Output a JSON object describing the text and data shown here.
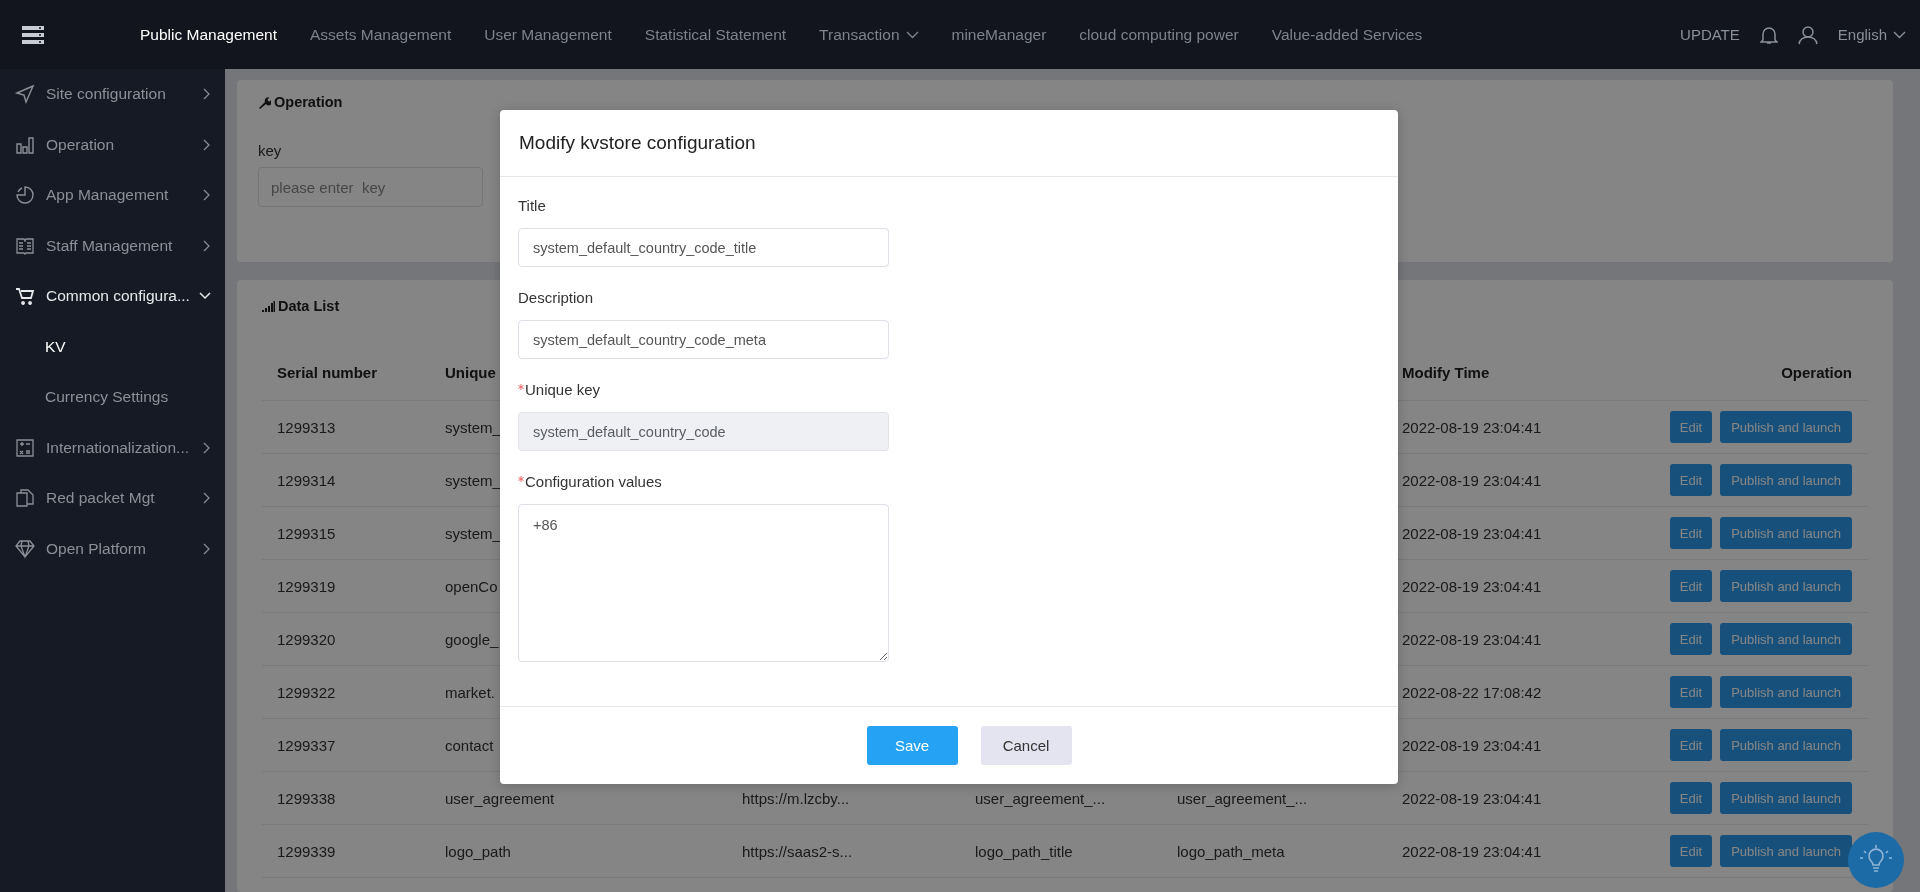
{
  "top_nav": {
    "items": [
      {
        "label": "Public Management",
        "selected": true,
        "has_dropdown": false
      },
      {
        "label": "Assets Management",
        "selected": false,
        "has_dropdown": false
      },
      {
        "label": "User Management",
        "selected": false,
        "has_dropdown": false
      },
      {
        "label": "Statistical Statement",
        "selected": false,
        "has_dropdown": false
      },
      {
        "label": "Transaction",
        "selected": false,
        "has_dropdown": true
      },
      {
        "label": "mineManager",
        "selected": false,
        "has_dropdown": false
      },
      {
        "label": "cloud computing power",
        "selected": false,
        "has_dropdown": false
      },
      {
        "label": "Value-added Services",
        "selected": false,
        "has_dropdown": false
      }
    ],
    "update_label": "UPDATE",
    "language": "English"
  },
  "sidebar": {
    "items": [
      {
        "label": "Site configuration",
        "expanded": false
      },
      {
        "label": "Operation",
        "expanded": false
      },
      {
        "label": "App Management",
        "expanded": false
      },
      {
        "label": "Staff Management",
        "expanded": false
      },
      {
        "label": "Common configura...",
        "expanded": true,
        "children": [
          {
            "label": "KV",
            "selected": true
          },
          {
            "label": "Currency Settings",
            "selected": false
          }
        ]
      },
      {
        "label": "Internationalization...",
        "expanded": false
      },
      {
        "label": "Red packet Mgt",
        "expanded": false
      },
      {
        "label": "Open Platform",
        "expanded": false
      }
    ]
  },
  "operation_panel": {
    "title": "Operation",
    "key_label": "key",
    "placeholder": "please enter  key"
  },
  "data_list": {
    "title": "Data List",
    "columns": [
      "Serial number",
      "Unique",
      null,
      null,
      null,
      "Modify Time",
      "Operation"
    ],
    "rows": [
      {
        "cells": [
          "1299313",
          "system_",
          null,
          null,
          null,
          "2022-08-19 23:04:41"
        ],
        "actions": [
          "Edit",
          "Publish and launch"
        ]
      },
      {
        "cells": [
          "1299314",
          "system_",
          null,
          null,
          null,
          "2022-08-19 23:04:41"
        ],
        "actions": [
          "Edit",
          "Publish and launch"
        ]
      },
      {
        "cells": [
          "1299315",
          "system_",
          null,
          null,
          null,
          "2022-08-19 23:04:41"
        ],
        "actions": [
          "Edit",
          "Publish and launch"
        ]
      },
      {
        "cells": [
          "1299319",
          "openCo",
          null,
          null,
          null,
          "2022-08-19 23:04:41"
        ],
        "actions": [
          "Edit",
          "Publish and launch"
        ]
      },
      {
        "cells": [
          "1299320",
          "google_",
          null,
          null,
          null,
          "2022-08-19 23:04:41"
        ],
        "actions": [
          "Edit",
          "Publish and launch"
        ]
      },
      {
        "cells": [
          "1299322",
          "market.",
          null,
          null,
          null,
          "2022-08-22 17:08:42"
        ],
        "actions": [
          "Edit",
          "Publish and launch"
        ]
      },
      {
        "cells": [
          "1299337",
          "contact",
          null,
          null,
          null,
          "2022-08-19 23:04:41"
        ],
        "actions": [
          "Edit",
          "Publish and launch"
        ]
      },
      {
        "cells": [
          "1299338",
          "user_agreement",
          "https://m.lzcby...",
          "user_agreement_...",
          "user_agreement_...",
          "2022-08-19 23:04:41"
        ],
        "actions": [
          "Edit",
          "Publish and launch"
        ]
      },
      {
        "cells": [
          "1299339",
          "logo_path",
          "https://saas2-s...",
          "logo_path_title",
          "logo_path_meta",
          "2022-08-19 23:04:41"
        ],
        "actions": [
          "Edit",
          "Publish and launch"
        ]
      }
    ]
  },
  "modal": {
    "title": "Modify kvstore configuration",
    "fields": [
      {
        "kind": "input",
        "label": "Title",
        "value": "system_default_country_code_title",
        "required": false,
        "disabled": false
      },
      {
        "kind": "input",
        "label": "Description",
        "value": "system_default_country_code_meta",
        "required": false,
        "disabled": false
      },
      {
        "kind": "input",
        "label": "Unique key",
        "value": "system_default_country_code",
        "required": true,
        "disabled": true
      },
      {
        "kind": "textarea",
        "label": "Configuration values",
        "value": "+86",
        "required": true,
        "disabled": false
      }
    ],
    "buttons": [
      {
        "label": "Save",
        "kind": "primary"
      },
      {
        "label": "Cancel",
        "kind": "secondary"
      }
    ]
  }
}
